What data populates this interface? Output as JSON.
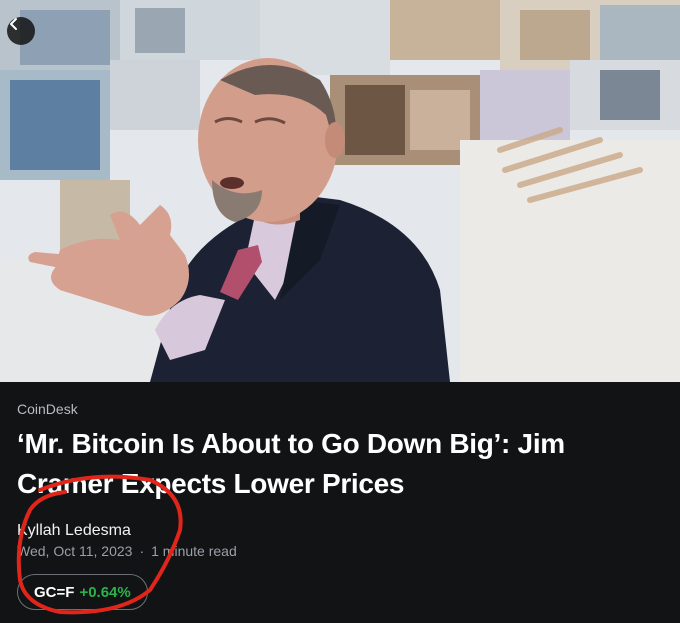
{
  "article": {
    "source": "CoinDesk",
    "headline": "‘Mr. Bitcoin Is About to Go Down Big’: Jim Cramer Expects Lower Prices",
    "author": "Kyllah Ledesma",
    "date": "Wed, Oct 11, 2023",
    "separator": "·",
    "read_time": "1 minute read"
  },
  "ticker": {
    "symbol": "GC=F",
    "change": "+0.64%",
    "change_color": "#2bb24c"
  },
  "icons": {
    "back": "chevron-left-icon"
  },
  "colors": {
    "background": "#111315",
    "annotation": "#e0261b"
  }
}
